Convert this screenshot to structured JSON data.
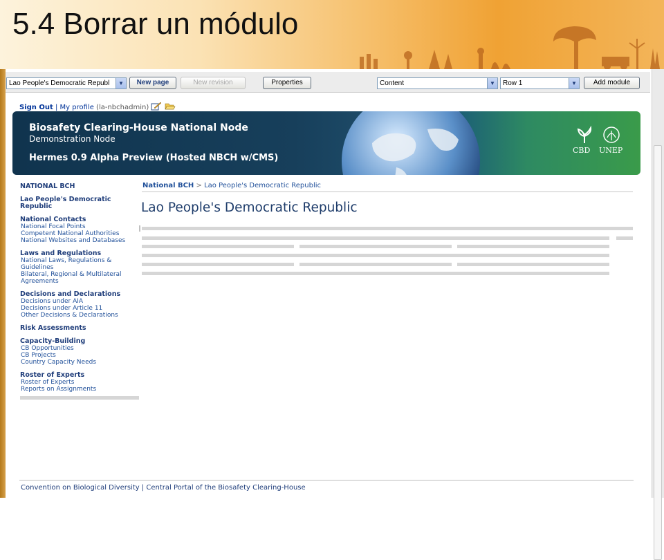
{
  "slide": {
    "title": "5.4  Borrar un módulo"
  },
  "toolbar": {
    "country_select": "Lao People's Democratic Republ",
    "new_page": "New page",
    "new_revision": "New revision",
    "properties": "Properties",
    "zone_select": "Content",
    "row_select": "Row 1",
    "add_module": "Add module"
  },
  "userbar": {
    "sign_out": "Sign Out",
    "separator": "|",
    "my_profile": "My profile",
    "username": "(la-nbchadmin)"
  },
  "banner": {
    "title": "Biosafety Clearing-House National Node",
    "subtitle": "Demonstration Node",
    "version": "Hermes 0.9 Alpha Preview (Hosted NBCH w/CMS)",
    "cbd": "CBD",
    "unep": "UNEP"
  },
  "sidebar": {
    "header": "NATIONAL BCH",
    "country": "Lao People's Democratic Republic",
    "sections": [
      {
        "title": "National Contacts",
        "links": [
          "National Focal Points",
          "Competent National Authorities",
          "National Websites and Databases"
        ]
      },
      {
        "title": "Laws and Regulations",
        "links": [
          "National Laws, Regulations & Guidelines",
          "Bilateral, Regional & Multilateral Agreements"
        ]
      },
      {
        "title": "Decisions and Declarations",
        "links": [
          "Decisions under AIA",
          "Decisions under Article 11",
          "Other Decisions & Declarations"
        ]
      },
      {
        "title": "Risk Assessments",
        "links": []
      },
      {
        "title": "Capacity-Building",
        "links": [
          "CB Opportunities",
          "CB Projects",
          "Country Capacity Needs"
        ]
      },
      {
        "title": "Roster of Experts",
        "links": [
          "Roster of Experts",
          "Reports on Assignments"
        ]
      }
    ]
  },
  "breadcrumb": {
    "root": "National BCH",
    "sep": ">",
    "current": "Lao People's Democratic Republic"
  },
  "main": {
    "heading": "Lao People's Democratic Republic"
  },
  "footer": {
    "text": "Convention on Biological Diversity | Central Portal of the Biosafety Clearing-House"
  }
}
